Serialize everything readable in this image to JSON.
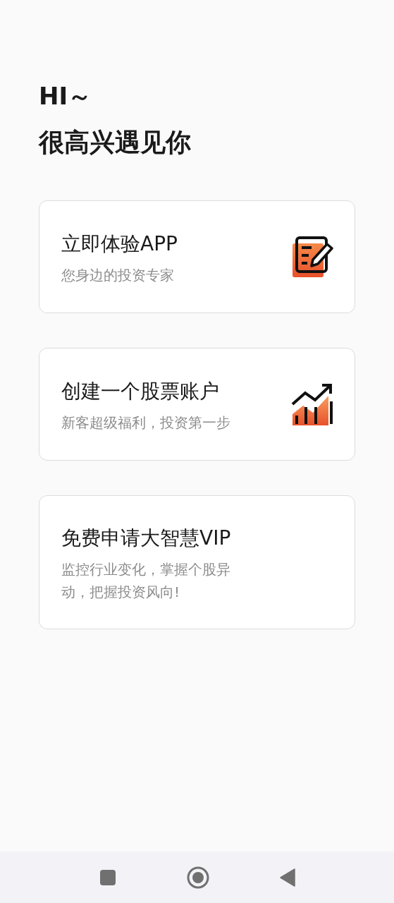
{
  "greeting": {
    "line_1": "HI～",
    "line_2": "很高兴遇见你"
  },
  "cards": [
    {
      "kind": "notes",
      "title": "立即体验APP",
      "subtitle": "您身边的投资专家"
    },
    {
      "kind": "growth",
      "title": "创建一个股票账户",
      "subtitle": "新客超级福利，投资第一步"
    },
    {
      "kind": "plain",
      "title": "免费申请大智慧VIP",
      "subtitle": "监控行业变化，掌握个股异动，把握投资风向!"
    }
  ]
}
